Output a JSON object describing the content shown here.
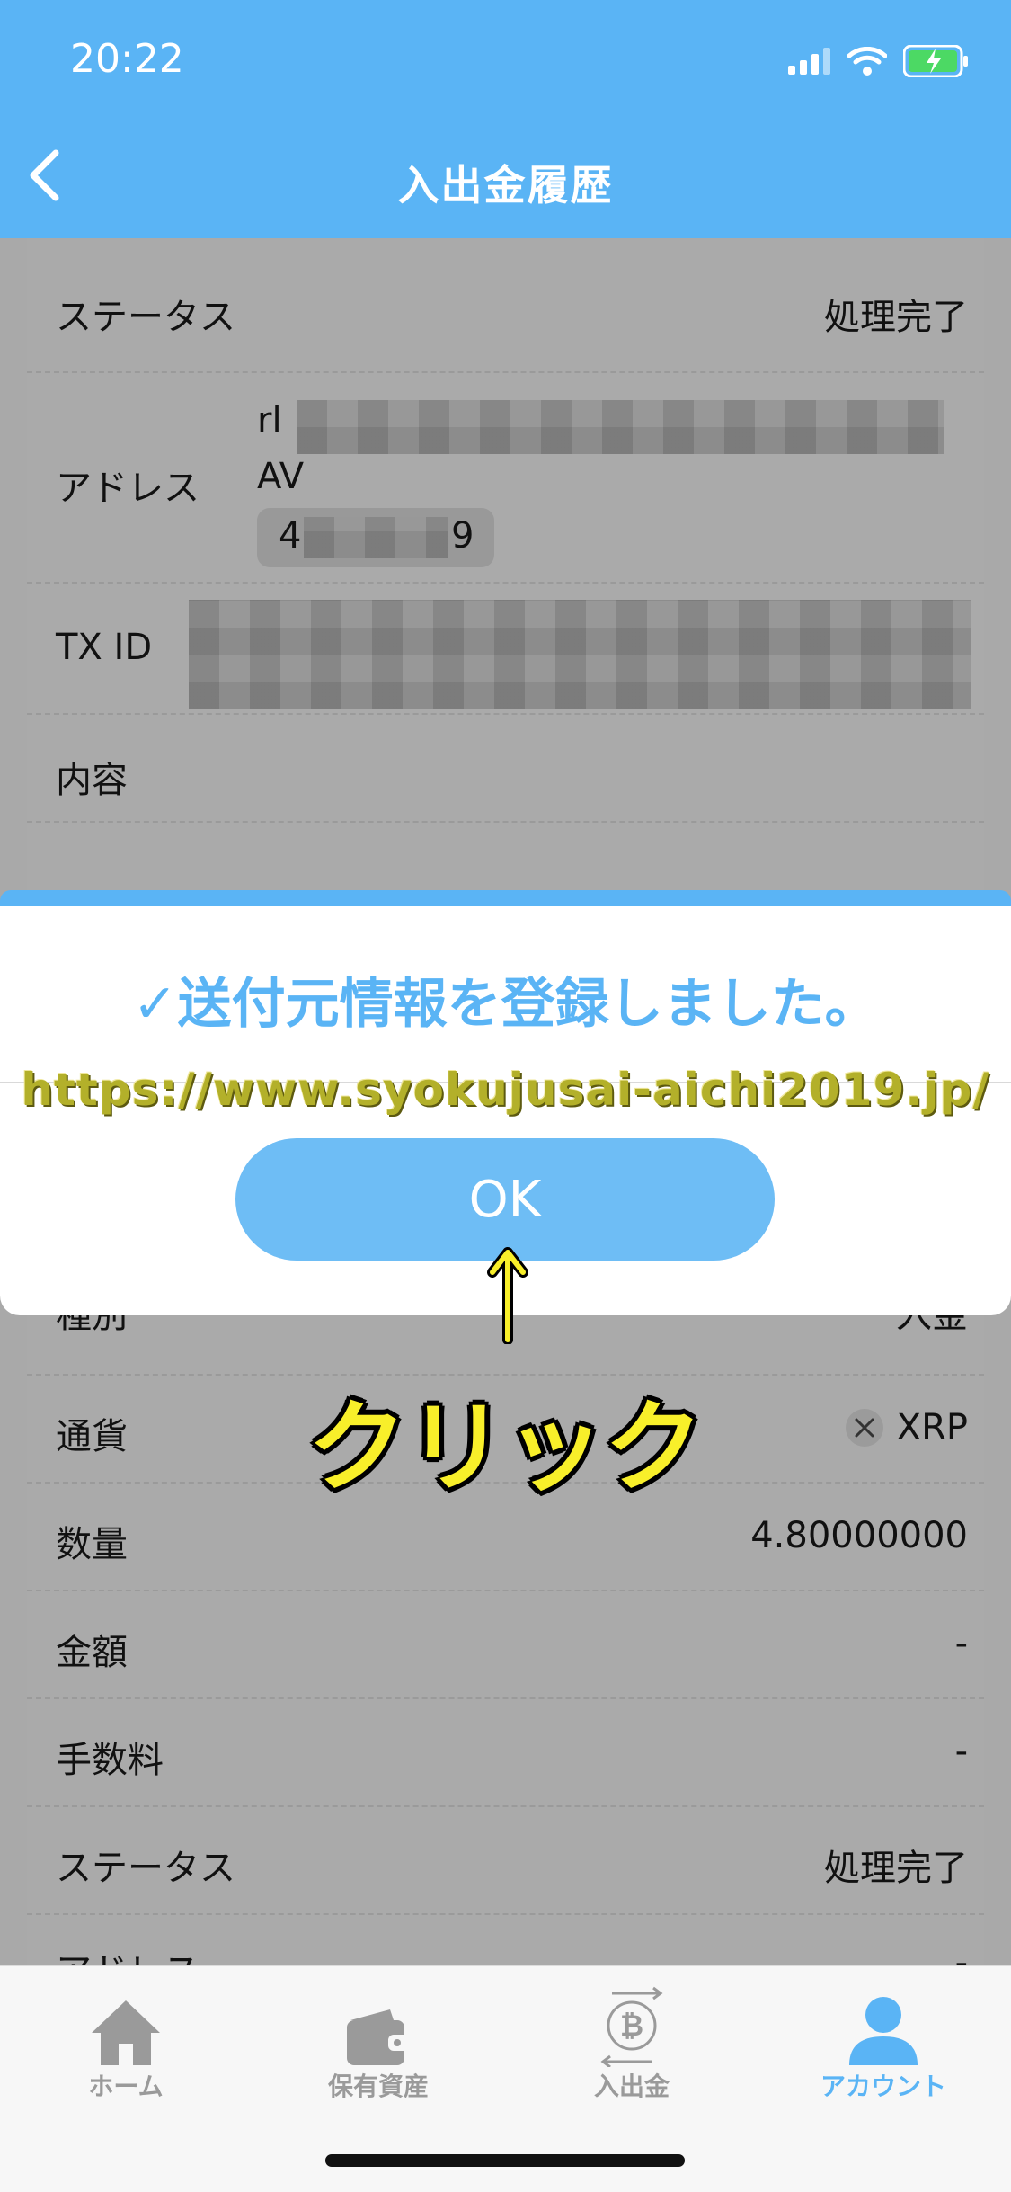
{
  "status_bar": {
    "time": "20:22"
  },
  "nav": {
    "title": "入出金履歴"
  },
  "details_top": {
    "status_label": "ステータス",
    "status_value": "処理完了",
    "address_label": "アドレス",
    "address_line1": "rl",
    "address_line2": "AV",
    "address_tag_start": "4",
    "address_tag_end": "9",
    "txid_label": "TX ID",
    "content_label": "内容"
  },
  "dialog": {
    "message": "✓送付元情報を登録しました。",
    "ok_label": "OK"
  },
  "watermark": "https://www.syokujusai-aichi2019.jp/",
  "annotation": "クリック",
  "details_bottom": {
    "type_label": "種別",
    "type_value": "入金",
    "currency_label": "通貨",
    "currency_value": "XRP",
    "amount_label": "数量",
    "amount_value": "4.80000000",
    "price_label": "金額",
    "price_value": "-",
    "fee_label": "手数料",
    "fee_value": "-",
    "status_label": "ステータス",
    "status_value": "処理完了",
    "address_label": "アドレス",
    "address_value": "-"
  },
  "tabs": [
    {
      "label": "ホーム",
      "icon": "home-icon"
    },
    {
      "label": "保有資産",
      "icon": "wallet-icon"
    },
    {
      "label": "入出金",
      "icon": "bitcoin-transfer-icon"
    },
    {
      "label": "アカウント",
      "icon": "account-icon"
    }
  ],
  "colors": {
    "primary": "#5ab4f5",
    "annotation": "#f8ef2a"
  }
}
